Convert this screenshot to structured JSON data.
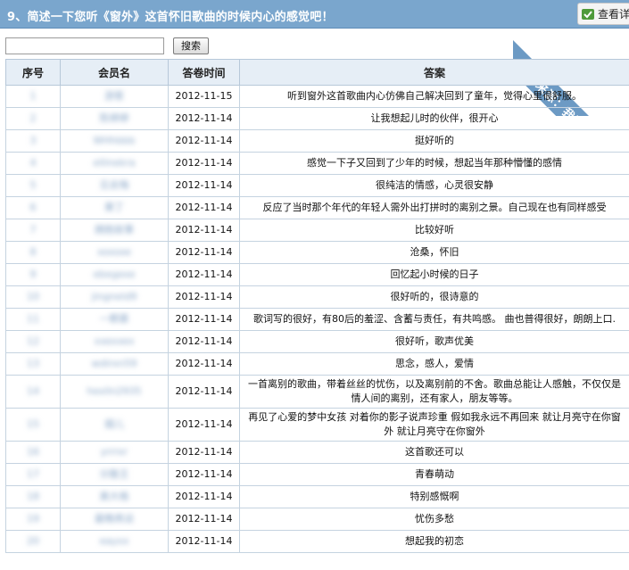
{
  "header": {
    "title": "9、简述一下您听《窗外》这首怀旧歌曲的时候内心的感觉吧！",
    "view_button_label": "查看详",
    "ribbon_text": "数据来源：我要调查网"
  },
  "search": {
    "input_value": "",
    "button_label": "搜索"
  },
  "table": {
    "columns": [
      "序号",
      "会员名",
      "答卷时间",
      "答案"
    ],
    "rows": [
      {
        "idx": "1",
        "member": "游客",
        "time": "2012-11-15",
        "answer": "听到窗外这首歌曲内心仿佛自己解决回到了童年，觉得心里很舒服。"
      },
      {
        "idx": "2",
        "member": "陈婷婷",
        "time": "2012-11-14",
        "answer": "让我想起儿时的伙伴，很开心"
      },
      {
        "idx": "3",
        "member": "WHhbbb",
        "time": "2012-11-14",
        "answer": "挺好听的"
      },
      {
        "idx": "4",
        "member": "ellinekra",
        "time": "2012-11-14",
        "answer": "感觉一下子又回到了少年的时候，想起当年那种懵懂的感情"
      },
      {
        "idx": "5",
        "member": "见去悔",
        "time": "2012-11-14",
        "answer": "很纯洁的情感，心灵很安静"
      },
      {
        "idx": "6",
        "member": "果丁",
        "time": "2012-11-14",
        "answer": "反应了当时那个年代的年轻人需外出打拼时的离别之景。自己现在也有同样感受"
      },
      {
        "idx": "7",
        "member": "拥抱故事",
        "time": "2012-11-14",
        "answer": "比较好听"
      },
      {
        "idx": "8",
        "member": "xoxoxe",
        "time": "2012-11-14",
        "answer": "沧桑，怀旧"
      },
      {
        "idx": "9",
        "member": "ebegexe",
        "time": "2012-11-14",
        "answer": "回忆起小时候的日子"
      },
      {
        "idx": "10",
        "member": "jingneld9",
        "time": "2012-11-14",
        "answer": "很好听的，很诗意的"
      },
      {
        "idx": "11",
        "member": "一颗慕",
        "time": "2012-11-14",
        "answer": "歌词写的很好，有80后的羞涩、含蓄与责任，有共鸣感。 曲也普得很好，朗朗上口."
      },
      {
        "idx": "12",
        "member": "xxexxex",
        "time": "2012-11-14",
        "answer": "很好听，歌声优美"
      },
      {
        "idx": "13",
        "member": "wdirxn59",
        "time": "2012-11-14",
        "answer": "思念，感人，爱情"
      },
      {
        "idx": "14",
        "member": "hexlln2935",
        "time": "2012-11-14",
        "answer": "一首离别的歌曲，带着丝丝的忧伤，以及离别前的不舍。歌曲总能让人感触，不仅仅是情人间的离别，还有家人，朋友等等。"
      },
      {
        "idx": "15",
        "member": "烟儿",
        "time": "2012-11-14",
        "answer": "再见了心爱的梦中女孩 对着你的影子说声珍重 假如我永远不再回来 就让月亮守在你窗外 就让月亮守在你窗外"
      },
      {
        "idx": "16",
        "member": "yrrrxr",
        "time": "2012-11-14",
        "answer": "这首歌还可以"
      },
      {
        "idx": "17",
        "member": "分散王",
        "time": "2012-11-14",
        "answer": "青春萌动"
      },
      {
        "idx": "18",
        "member": "美大格",
        "time": "2012-11-14",
        "answer": "特别感慨啊"
      },
      {
        "idx": "19",
        "member": "最晚再谈",
        "time": "2012-11-14",
        "answer": "忧伤多愁"
      },
      {
        "idx": "20",
        "member": "eayxx",
        "time": "2012-11-14",
        "answer": "想起我的初恋"
      }
    ]
  }
}
